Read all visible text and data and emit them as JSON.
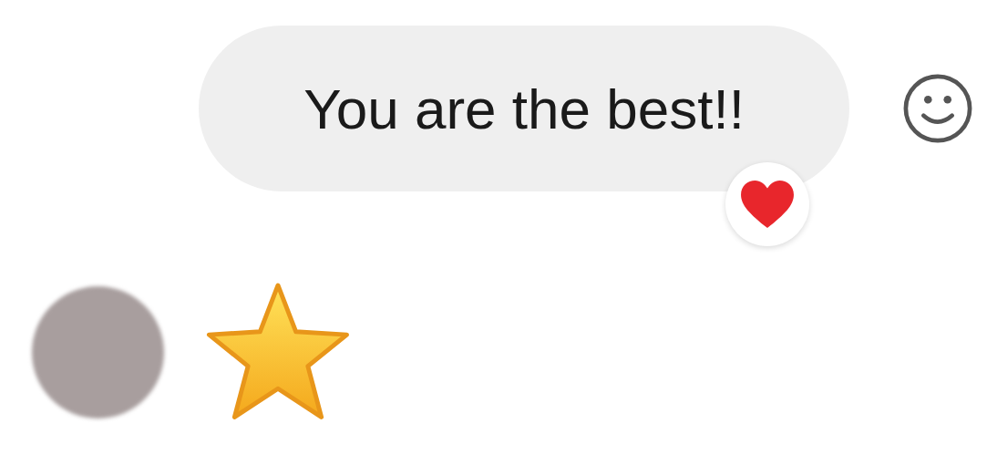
{
  "outgoing_message": {
    "text": "You are the best!!",
    "reacted": true
  }
}
